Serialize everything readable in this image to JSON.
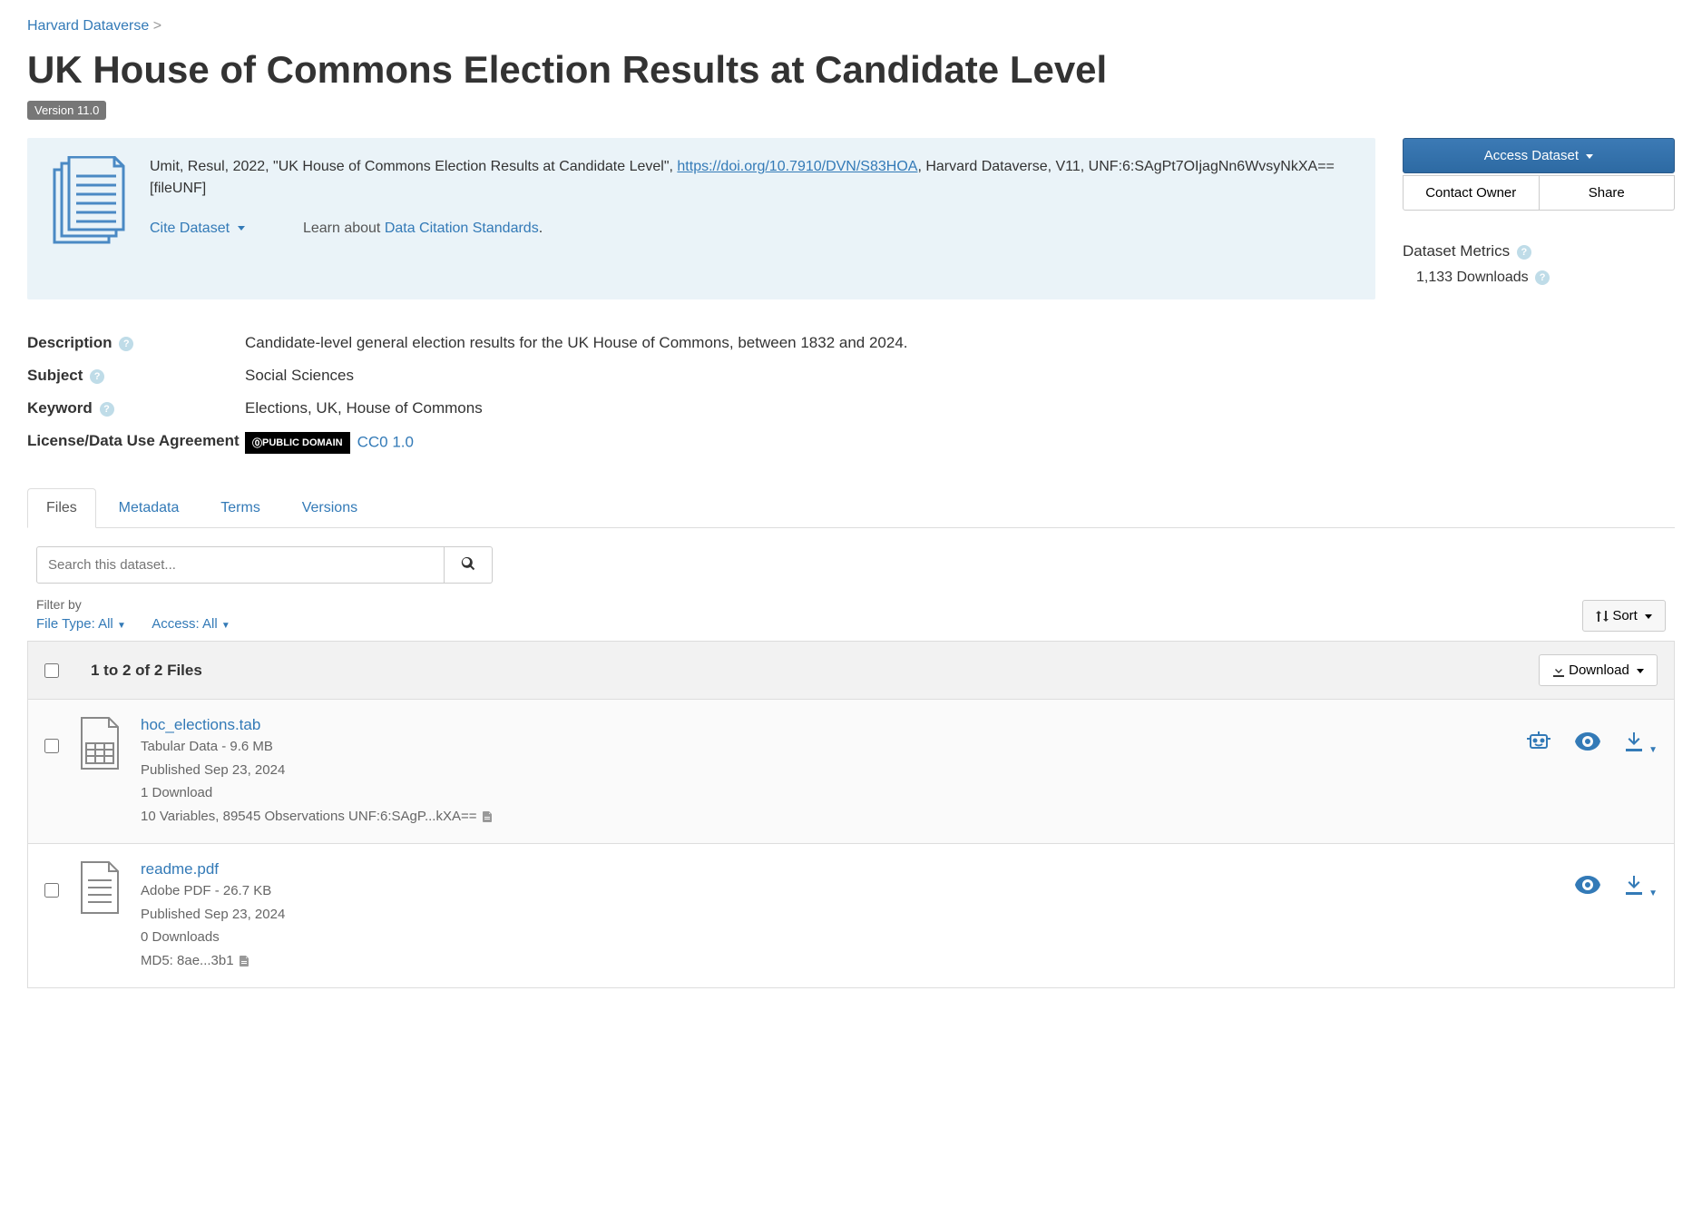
{
  "breadcrumb": {
    "root": "Harvard Dataverse",
    "sep": ">"
  },
  "title": "UK House of Commons Election Results at Candidate Level",
  "version_label": "Version 11.0",
  "citation": {
    "text_before": "Umit, Resul, 2022, \"UK House of Commons Election Results at Candidate Level\", ",
    "doi": "https://doi.org/10.7910/DVN/S83HOA",
    "text_after": ", Harvard Dataverse, V11, UNF:6:SAgPt7OIjagNn6WvsyNkXA== [fileUNF]",
    "cite_label": "Cite Dataset",
    "learn_prefix": "Learn about ",
    "learn_link": "Data Citation Standards",
    "learn_suffix": "."
  },
  "sidebar": {
    "access_label": "Access Dataset",
    "contact_label": "Contact Owner",
    "share_label": "Share",
    "metrics_title": "Dataset Metrics",
    "downloads_count": "1,133 Downloads"
  },
  "metadata": {
    "description": {
      "label": "Description",
      "value": "Candidate-level general election results for the UK House of Commons, between 1832 and 2024."
    },
    "subject": {
      "label": "Subject",
      "value": "Social Sciences"
    },
    "keyword": {
      "label": "Keyword",
      "value": "Elections, UK, House of Commons"
    },
    "license": {
      "label": "License/Data Use Agreement",
      "badge": "PUBLIC DOMAIN",
      "link": "CC0 1.0"
    }
  },
  "tabs": {
    "files": "Files",
    "metadata": "Metadata",
    "terms": "Terms",
    "versions": "Versions"
  },
  "search": {
    "placeholder": "Search this dataset..."
  },
  "filters": {
    "filter_by": "Filter by",
    "file_type": "File Type: All",
    "access": "Access: All",
    "sort": "Sort"
  },
  "files_section": {
    "count_label": "1 to 2 of 2 Files",
    "download_label": "Download"
  },
  "files": [
    {
      "name": "hoc_elections.tab",
      "type_size": "Tabular Data - 9.6 MB",
      "published": "Published Sep 23, 2024",
      "downloads": "1 Download",
      "details": "10 Variables, 89545 Observations UNF:6:SAgP...kXA==",
      "icon_type": "tabular",
      "has_explore": true
    },
    {
      "name": "readme.pdf",
      "type_size": "Adobe PDF - 26.7 KB",
      "published": "Published Sep 23, 2024",
      "downloads": "0 Downloads",
      "details": "MD5: 8ae...3b1",
      "icon_type": "document",
      "has_explore": false
    }
  ]
}
